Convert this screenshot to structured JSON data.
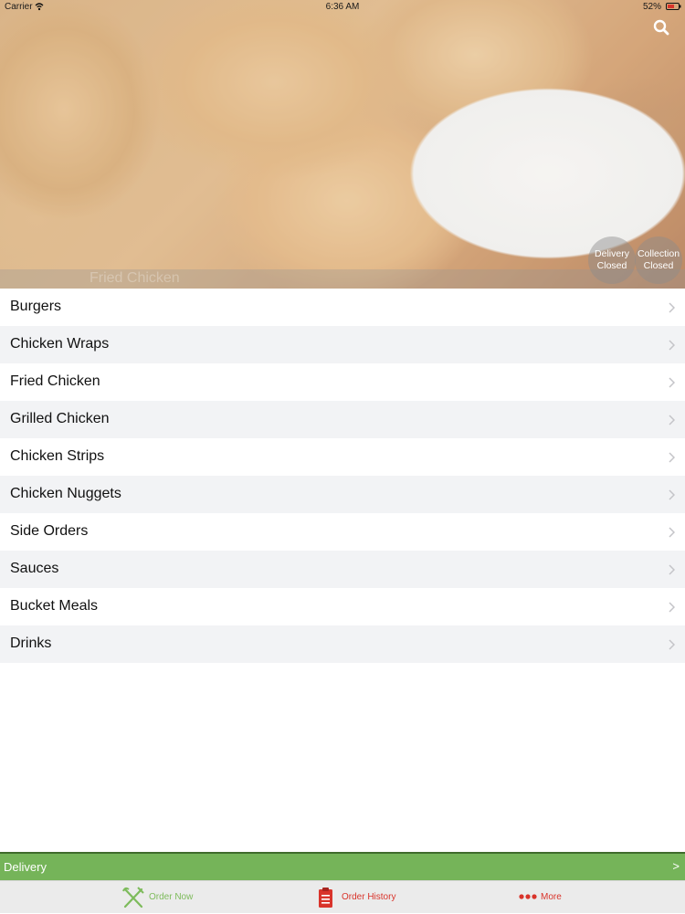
{
  "status_bar": {
    "carrier": "Carrier",
    "time": "6:36 AM",
    "battery": "52%"
  },
  "hero": {
    "caption": "Fried Chicken",
    "delivery_status": {
      "label": "Delivery",
      "state": "Closed"
    },
    "collection_status": {
      "label": "Collection",
      "state": "Closed"
    }
  },
  "categories": [
    {
      "label": "Burgers"
    },
    {
      "label": "Chicken Wraps"
    },
    {
      "label": "Fried Chicken"
    },
    {
      "label": "Grilled Chicken"
    },
    {
      "label": "Chicken Strips"
    },
    {
      "label": "Chicken Nuggets"
    },
    {
      "label": "Side Orders"
    },
    {
      "label": "Sauces"
    },
    {
      "label": "Bucket Meals"
    },
    {
      "label": "Drinks"
    }
  ],
  "delivery_bar": {
    "label": "Delivery",
    "arrow": ">"
  },
  "tab_bar": {
    "order_now": {
      "label": "Order Now",
      "icon": "fork-knife-icon"
    },
    "order_history": {
      "label": "Order History",
      "icon": "clipboard-icon"
    },
    "more": {
      "label": "More",
      "icon": "more-dots-icon"
    }
  },
  "colors": {
    "delivery_bar": "#75b459",
    "order_now": "#7dbb5b",
    "order_history": "#d9342b",
    "more": "#d9342b",
    "row_alt": "#f2f3f5"
  }
}
